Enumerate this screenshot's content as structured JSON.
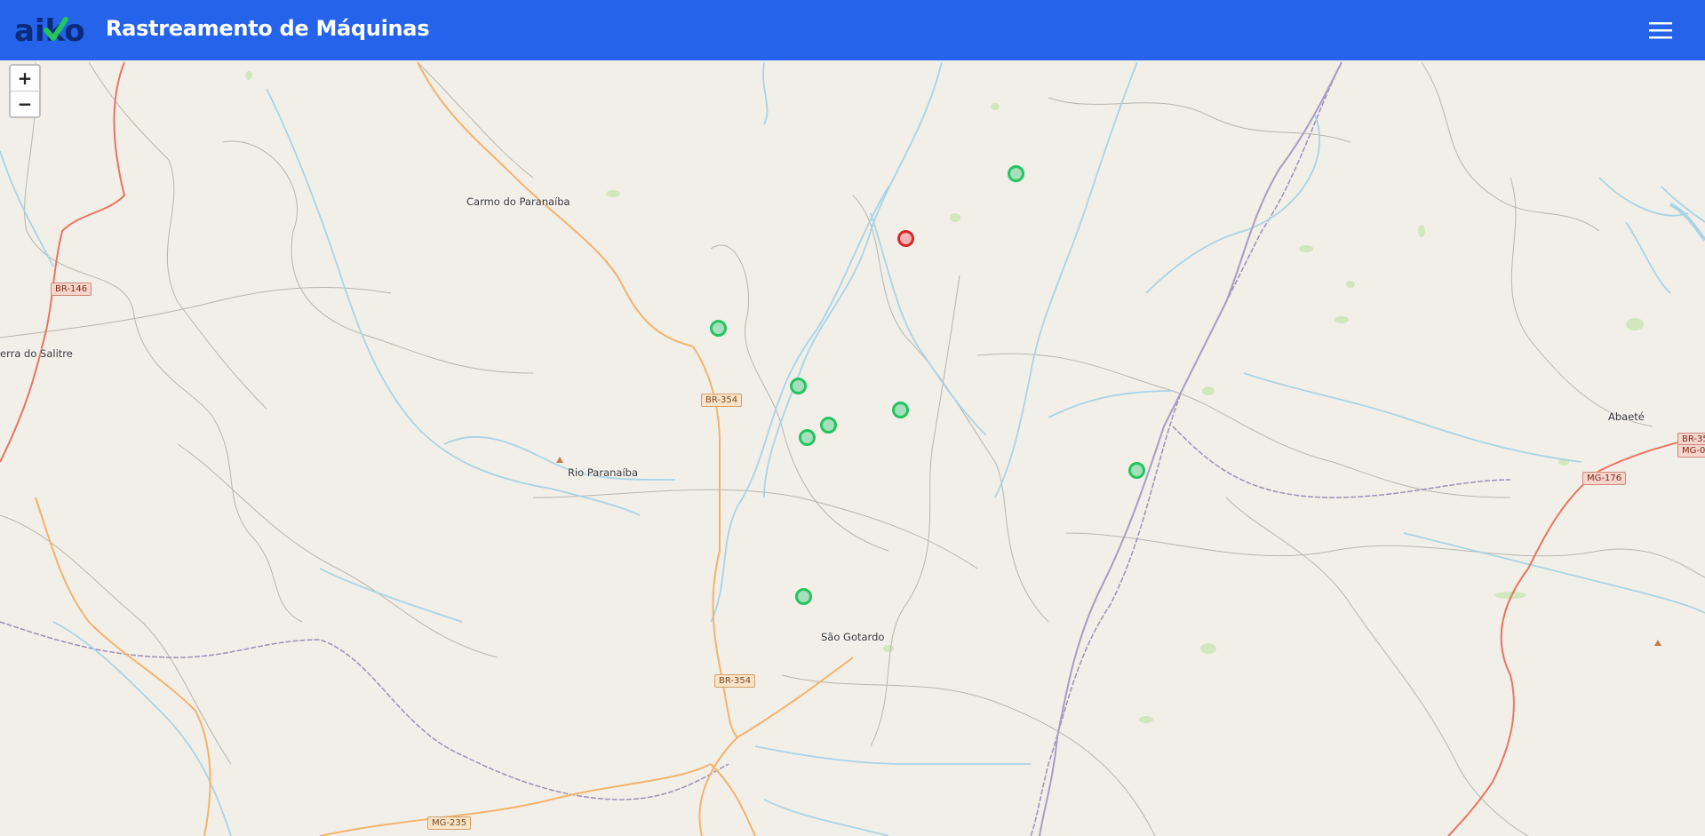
{
  "header": {
    "logo_text": "aiko",
    "title": "Rastreamento de Máquinas",
    "menu_icon": "hamburger-menu-icon",
    "bg_color": "#2563eb"
  },
  "map": {
    "zoom_in_label": "+",
    "zoom_out_label": "−",
    "places": {
      "carmo": "Carmo do Paranaíba",
      "rio": "Rio Paranaíba",
      "sao_gotardo": "São Gotardo",
      "serra": "erra do Salitre",
      "abaete": "Abaeté"
    },
    "roads": {
      "br146": "BR-146",
      "br354_a": "BR-354",
      "br354_b": "BR-354",
      "mg176": "MG-176",
      "mg235": "MG-235",
      "br35x": "BR-35",
      "mg0x": "MG-0"
    },
    "markers": [
      {
        "status": "ok"
      },
      {
        "status": "alert"
      },
      {
        "status": "ok"
      },
      {
        "status": "ok"
      },
      {
        "status": "ok"
      },
      {
        "status": "ok"
      },
      {
        "status": "ok"
      },
      {
        "status": "ok"
      },
      {
        "status": "ok"
      }
    ],
    "colors": {
      "ok": "#22c55e",
      "alert": "#dc2626",
      "water": "#a8d4e6",
      "road": "#f3b36b"
    }
  }
}
